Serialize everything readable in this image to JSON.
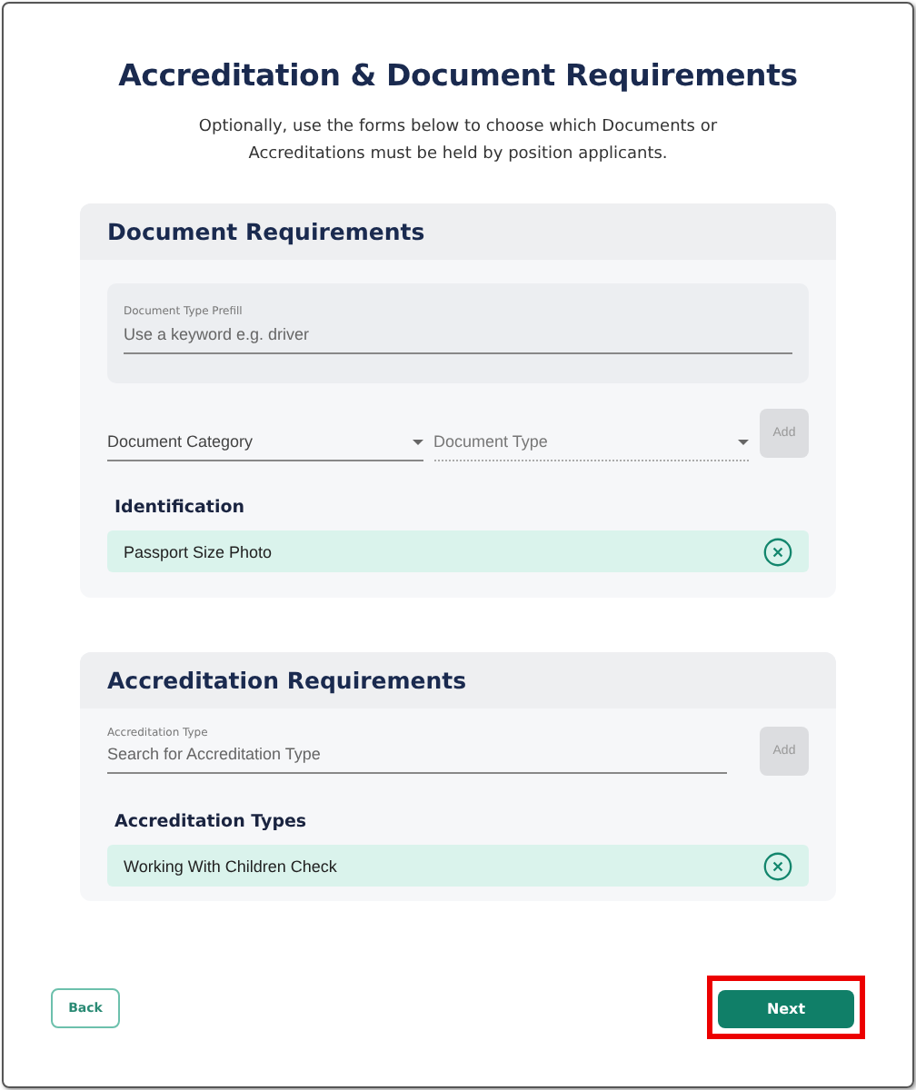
{
  "title": "Accreditation & Document Requirements",
  "subtitle": "Optionally, use the forms below to choose which Documents or Accreditations must be held by position applicants.",
  "document_section": {
    "title": "Document Requirements",
    "prefill_field": {
      "label": "Document Type Prefill",
      "placeholder": "Use a keyword e.g. driver"
    },
    "category_select": {
      "placeholder": "Document Category",
      "disabled": false
    },
    "type_select": {
      "placeholder": "Document Type",
      "disabled": true
    },
    "add_button": {
      "label": "Add",
      "disabled": true
    },
    "group_title": "Identification",
    "items": [
      {
        "label": "Passport Size Photo"
      }
    ]
  },
  "accreditation_section": {
    "title": "Accreditation Requirements",
    "type_field": {
      "label": "Accreditation Type",
      "placeholder": "Search for Accreditation Type"
    },
    "add_button": {
      "label": "Add",
      "disabled": true
    },
    "group_title": "Accreditation Types",
    "items": [
      {
        "label": "Working With Children Check"
      }
    ]
  },
  "back_button": {
    "label": "Back"
  },
  "next_button": {
    "label": "Next",
    "highlighted": true
  }
}
